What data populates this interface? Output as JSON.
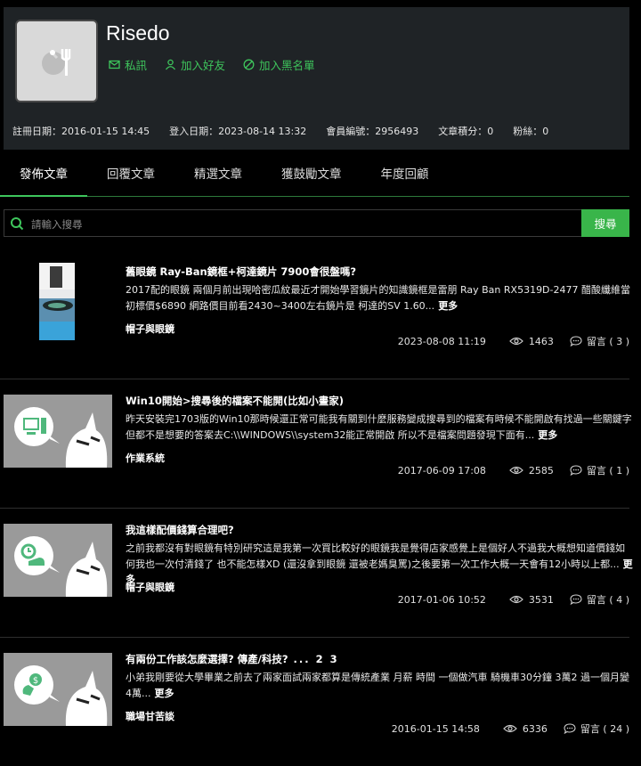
{
  "profile": {
    "username": "Risedo",
    "actions": {
      "message": "私訊",
      "add_friend": "加入好友",
      "blacklist": "加入黑名單"
    },
    "stats": {
      "register": "註冊日期：2016-01-15 14:45",
      "login": "登入日期：2023-08-14 13:32",
      "member_id": "會員編號：2956493",
      "points": "文章積分：0",
      "fans": "粉絲：0"
    }
  },
  "tabs": [
    "發佈文章",
    "回覆文章",
    "精選文章",
    "獲鼓勵文章",
    "年度回顧"
  ],
  "search": {
    "placeholder": "請輸入搜尋",
    "button": "搜尋"
  },
  "articles": [
    {
      "title": "舊眼鏡 Ray-Ban鏡框+柯達鏡片 7900會很盤嗎?",
      "pager": "",
      "excerpt": "2017配的眼鏡 兩個月前出現哈密瓜紋最近才開始學習鏡片的知識鏡框是雷朋 Ray Ban RX5319D-2477 醋酸纖維當初標價$6890 網路價目前看2430~3400左右鏡片是 柯達的SV 1.60...",
      "more": "更多",
      "category": "帽子與眼鏡",
      "date": "2023-08-08 11:19",
      "views": "1463",
      "comments": "留言 ( 3 )",
      "thumb_icon": "photo"
    },
    {
      "title": "Win10開始>搜尋後的檔案不能開(比如小畫家)",
      "pager": "",
      "excerpt": "昨天安裝完1703版的Win10那時候還正常可能我有關到什麼服務變成搜尋到的檔案有時候不能開啟有找過一些關鍵字但都不是想要的答案去C:\\\\WINDOWS\\\\system32能正常開啟 所以不是檔案問題發現下面有...",
      "more": "更多",
      "category": "作業系統",
      "date": "2017-06-09 17:08",
      "views": "2585",
      "comments": "留言 ( 1 )",
      "thumb_icon": "computer"
    },
    {
      "title": "我這樣配價錢算合理吧?",
      "pager": "",
      "excerpt": "之前我都沒有對眼鏡有特別研究這是我第一次買比較好的眼鏡我是覺得店家感覺上是個好人不過我大概想知道價錢如何我也一次付清錢了 也不能怎樣XD (還沒拿到眼鏡 還被老媽臭罵)之後要第一次工作大概一天會有12小時以上都...",
      "more": "更多",
      "category": "帽子與眼鏡",
      "date": "2017-01-06 10:52",
      "views": "3531",
      "comments": "留言 ( 4 )",
      "thumb_icon": "watch-shoe"
    },
    {
      "title": "有兩份工作該怎麼選擇? 傳產/科技?",
      "pager": "...  2  3",
      "excerpt": "小弟我剛要從大學畢業之前去了兩家面試兩家都算是傳統產業 月薪 時間 一個做汽車 騎機車30分鐘 3萬2 過一個月變4萬...",
      "more": "更多",
      "category": "職場甘苦談",
      "date": "2016-01-15 14:58",
      "views": "6336",
      "comments": "留言 ( 24 )",
      "thumb_icon": "money"
    }
  ],
  "colors": {
    "accent": "#3ec55c",
    "button": "#39b54a",
    "panel": "#1f2326",
    "background": "#000000"
  }
}
